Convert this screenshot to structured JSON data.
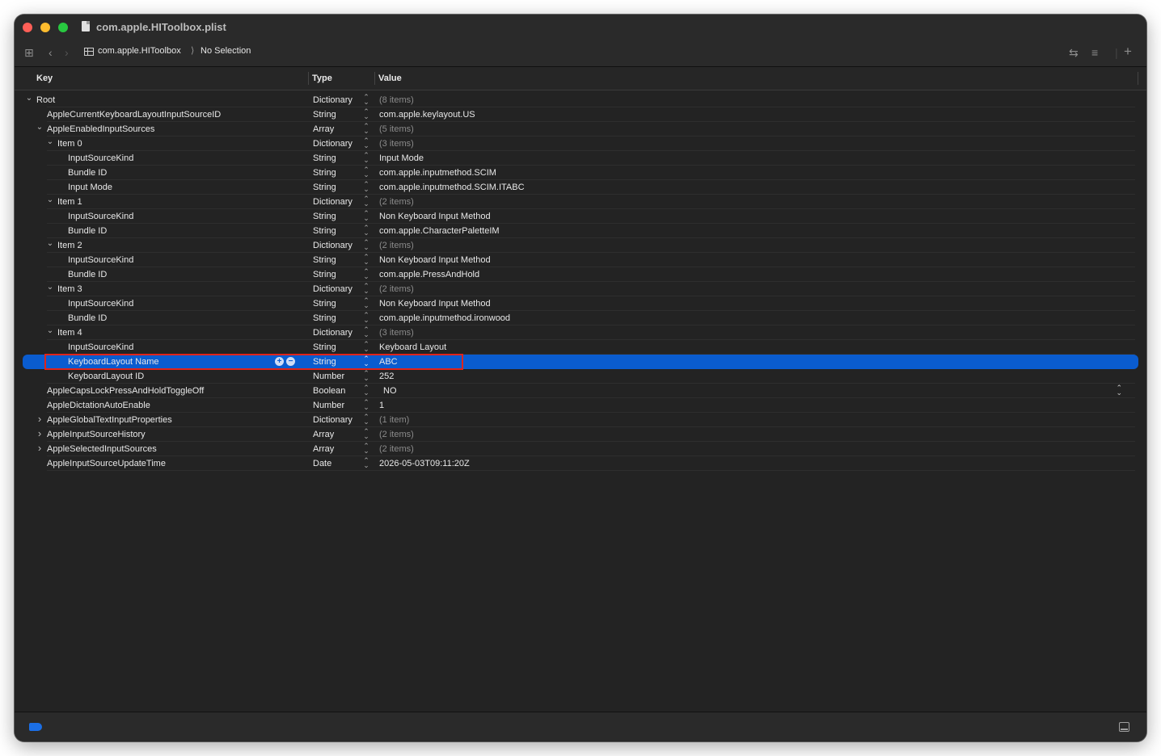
{
  "window": {
    "title": "com.apple.HIToolbox.plist"
  },
  "breadcrumb": {
    "file": "com.apple.HIToolbox",
    "separator": "⟩",
    "selection": "No Selection"
  },
  "columns": {
    "key": "Key",
    "type": "Type",
    "value": "Value"
  },
  "rows": [
    {
      "key": "Root",
      "type": "Dictionary",
      "value": "(8 items)",
      "level": 0,
      "disc": "open",
      "muted": true
    },
    {
      "key": "AppleCurrentKeyboardLayoutInputSourceID",
      "type": "String",
      "value": "com.apple.keylayout.US",
      "level": 1,
      "disc": "none",
      "muted": false
    },
    {
      "key": "AppleEnabledInputSources",
      "type": "Array",
      "value": "(5 items)",
      "level": 1,
      "disc": "open",
      "muted": true
    },
    {
      "key": "Item 0",
      "type": "Dictionary",
      "value": "(3 items)",
      "level": 2,
      "disc": "open",
      "muted": true
    },
    {
      "key": "InputSourceKind",
      "type": "String",
      "value": "Input Mode",
      "level": 3,
      "disc": "none",
      "muted": false
    },
    {
      "key": "Bundle ID",
      "type": "String",
      "value": "com.apple.inputmethod.SCIM",
      "level": 3,
      "disc": "none",
      "muted": false
    },
    {
      "key": "Input Mode",
      "type": "String",
      "value": "com.apple.inputmethod.SCIM.ITABC",
      "level": 3,
      "disc": "none",
      "muted": false
    },
    {
      "key": "Item 1",
      "type": "Dictionary",
      "value": "(2 items)",
      "level": 2,
      "disc": "open",
      "muted": true
    },
    {
      "key": "InputSourceKind",
      "type": "String",
      "value": "Non Keyboard Input Method",
      "level": 3,
      "disc": "none",
      "muted": false
    },
    {
      "key": "Bundle ID",
      "type": "String",
      "value": "com.apple.CharacterPaletteIM",
      "level": 3,
      "disc": "none",
      "muted": false
    },
    {
      "key": "Item 2",
      "type": "Dictionary",
      "value": "(2 items)",
      "level": 2,
      "disc": "open",
      "muted": true
    },
    {
      "key": "InputSourceKind",
      "type": "String",
      "value": "Non Keyboard Input Method",
      "level": 3,
      "disc": "none",
      "muted": false
    },
    {
      "key": "Bundle ID",
      "type": "String",
      "value": "com.apple.PressAndHold",
      "level": 3,
      "disc": "none",
      "muted": false
    },
    {
      "key": "Item 3",
      "type": "Dictionary",
      "value": "(2 items)",
      "level": 2,
      "disc": "open",
      "muted": true
    },
    {
      "key": "InputSourceKind",
      "type": "String",
      "value": "Non Keyboard Input Method",
      "level": 3,
      "disc": "none",
      "muted": false
    },
    {
      "key": "Bundle ID",
      "type": "String",
      "value": "com.apple.inputmethod.ironwood",
      "level": 3,
      "disc": "none",
      "muted": false
    },
    {
      "key": "Item 4",
      "type": "Dictionary",
      "value": "(3 items)",
      "level": 2,
      "disc": "open",
      "muted": true
    },
    {
      "key": "InputSourceKind",
      "type": "String",
      "value": "Keyboard Layout",
      "level": 3,
      "disc": "none",
      "muted": false
    },
    {
      "key": "KeyboardLayout Name",
      "type": "String",
      "value": "ABC",
      "level": 3,
      "disc": "none",
      "muted": false,
      "selected": true
    },
    {
      "key": "KeyboardLayout ID",
      "type": "Number",
      "value": "252",
      "level": 3,
      "disc": "none",
      "muted": false
    },
    {
      "key": "AppleCapsLockPressAndHoldToggleOff",
      "type": "Boolean",
      "value": "NO",
      "level": 1,
      "disc": "none",
      "muted": false,
      "dropdown": true
    },
    {
      "key": "AppleDictationAutoEnable",
      "type": "Number",
      "value": "1",
      "level": 1,
      "disc": "none",
      "muted": false
    },
    {
      "key": "AppleGlobalTextInputProperties",
      "type": "Dictionary",
      "value": "(1 item)",
      "level": 1,
      "disc": "closed",
      "muted": true
    },
    {
      "key": "AppleInputSourceHistory",
      "type": "Array",
      "value": "(2 items)",
      "level": 1,
      "disc": "closed",
      "muted": true
    },
    {
      "key": "AppleSelectedInputSources",
      "type": "Array",
      "value": "(2 items)",
      "level": 1,
      "disc": "closed",
      "muted": true
    },
    {
      "key": "AppleInputSourceUpdateTime",
      "type": "Date",
      "value": "2026-05-03T09:11:20Z",
      "level": 1,
      "disc": "none",
      "muted": false
    }
  ],
  "selected_row_actions": {
    "add": "+",
    "remove": "−"
  },
  "colors": {
    "selection": "#0a5ccf",
    "highlight_box": "#e0241b",
    "background": "#232323"
  }
}
